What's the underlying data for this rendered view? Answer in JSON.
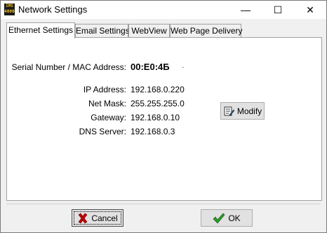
{
  "window": {
    "title": "Network Settings",
    "icon_text": "IMS 4000",
    "minimize_glyph": "—",
    "maximize_glyph": "☐",
    "close_glyph": "✕"
  },
  "tabs": [
    {
      "label": "Ethernet Settings",
      "active": true
    },
    {
      "label": "Email Settings",
      "active": false
    },
    {
      "label": "WebView",
      "active": false
    },
    {
      "label": "Web Page Delivery",
      "active": false
    }
  ],
  "ethernet": {
    "serial_label": "Serial Number / MAC Address:",
    "serial_value": "00:E0:4Б",
    "serial_suffix": ".",
    "ip_label": "IP Address:",
    "ip_value": "192.168.0.220",
    "mask_label": "Net Mask:",
    "mask_value": "255.255.255.0",
    "gateway_label": "Gateway:",
    "gateway_value": "192.168.0.10",
    "dns_label": "DNS Server:",
    "dns_value": "192.168.0.3",
    "modify_label": "Modify"
  },
  "footer": {
    "cancel_label": "Cancel",
    "ok_label": "OK"
  },
  "colors": {
    "cancel_x": "#c00000",
    "ok_check": "#2a9d2a"
  }
}
